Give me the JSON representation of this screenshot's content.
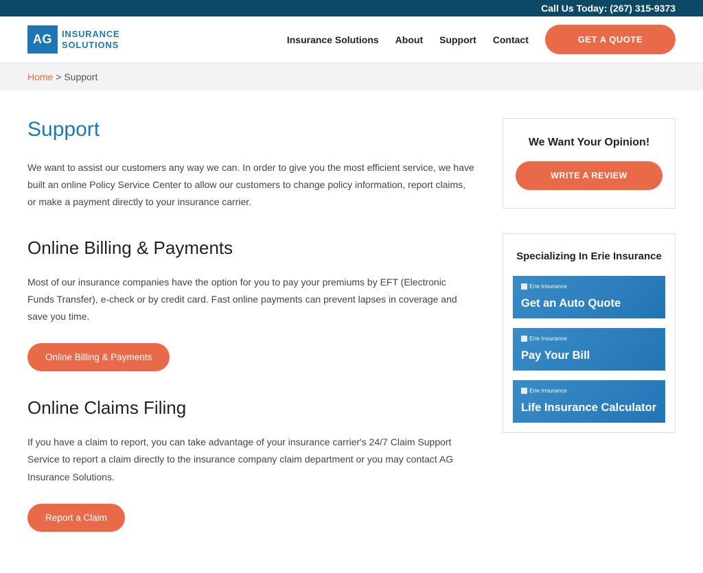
{
  "topbar": {
    "call_text": "Call Us Today: (267) 315-9373"
  },
  "logo": {
    "box": "AG",
    "line1": "INSURANCE",
    "line2": "SOLUTIONS"
  },
  "nav": {
    "items": [
      "Insurance Solutions",
      "About",
      "Support",
      "Contact"
    ],
    "quote": "GET A QUOTE"
  },
  "breadcrumb": {
    "home": "Home",
    "sep": " > ",
    "current": "Support"
  },
  "page": {
    "title": "Support",
    "intro": "We want to assist our customers any way we can. In order to give you the most efficient service, we have built an online Policy Service Center to allow our customers to change policy information, report claims, or make a payment directly to your insurance carrier.",
    "billing": {
      "heading": "Online Billing & Payments",
      "body": "Most of our insurance companies have the option for you to pay your premiums by EFT (Electronic Funds Transfer), e-check or by credit card. Fast online payments can prevent lapses in coverage and save you time.",
      "button": "Online Billing & Payments"
    },
    "claims": {
      "heading": "Online Claims Filing",
      "body": "If you have a claim to report, you can take advantage of your insurance carrier's 24/7 Claim Support Service to report a claim directly to the insurance company claim department or you may contact AG Insurance Solutions.",
      "button": "Report a Claim"
    }
  },
  "sidebar": {
    "opinion": {
      "heading": "We Want Your Opinion!",
      "button": "WRITE A REVIEW"
    },
    "erie": {
      "heading": "Specializing In Erie Insurance",
      "brand": "Erie Insurance",
      "tiles": [
        "Get an Auto Quote",
        "Pay Your Bill",
        "Life Insurance Calculator"
      ]
    }
  }
}
